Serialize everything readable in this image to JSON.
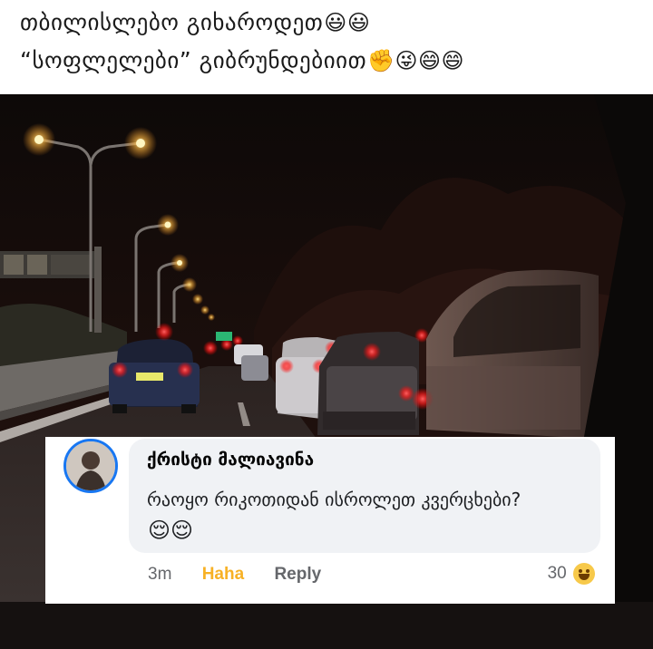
{
  "caption": {
    "line1": "თბილისლებო გიხაროდეთ",
    "line1_emoji": "😃😃",
    "line2": "“სოფლელები” გიბრუნდებიით",
    "line2_emoji": "✊😜😄😄"
  },
  "comment": {
    "author": "ქრისტი მალიავინა",
    "text": "რაოყო რიკოთიდან ისროლეთ კვერცხები?",
    "text_emoji": "😌😌",
    "time": "3m",
    "reaction_action": "Haha",
    "reply_label": "Reply",
    "reaction_count": "30",
    "reaction_icon": "haha-icon"
  },
  "colors": {
    "avatar_ring": "#1877f2",
    "haha": "#f7b125",
    "taillight": "#ff1e1e",
    "streetlight": "#ffcc55"
  }
}
